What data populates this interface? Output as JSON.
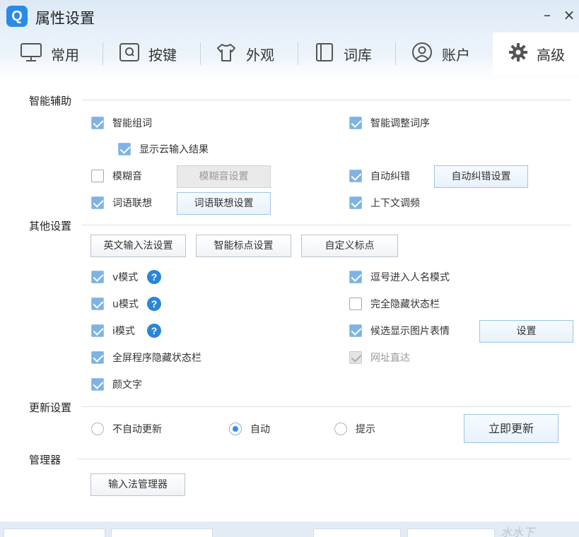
{
  "window": {
    "title": "属性设置",
    "logo_letter": "Q",
    "minimize": "–",
    "close": "×"
  },
  "tabs": [
    {
      "label": "常用",
      "icon": "monitor-icon"
    },
    {
      "label": "按键",
      "icon": "key-icon"
    },
    {
      "label": "外观",
      "icon": "tshirt-icon"
    },
    {
      "label": "词库",
      "icon": "book-icon"
    },
    {
      "label": "账户",
      "icon": "user-icon"
    },
    {
      "label": "高级",
      "icon": "gear-icon",
      "active": true
    }
  ],
  "smart_assist": {
    "label": "智能辅助",
    "smart_phrase": {
      "label": "智能组词",
      "checked": true
    },
    "smart_order": {
      "label": "智能调整词序",
      "checked": true
    },
    "cloud_result": {
      "label": "显示云输入结果",
      "checked": true
    },
    "fuzzy": {
      "label": "模糊音",
      "checked": false
    },
    "fuzzy_settings": "模糊音设置",
    "auto_correct": {
      "label": "自动纠错",
      "checked": true
    },
    "auto_correct_settings": "自动纠错设置",
    "association": {
      "label": "词语联想",
      "checked": true
    },
    "association_settings": "词语联想设置",
    "context_tuning": {
      "label": "上下文调频",
      "checked": true
    }
  },
  "other_settings": {
    "label": "其他设置",
    "english_settings": "英文输入法设置",
    "punct_settings": "智能标点设置",
    "custom_punct": "自定义标点",
    "v_mode": {
      "label": "v模式",
      "checked": true
    },
    "u_mode": {
      "label": "u模式",
      "checked": true
    },
    "i_mode": {
      "label": "i模式",
      "checked": true
    },
    "help_glyph": "?",
    "comma_name": {
      "label": "逗号进入人名模式",
      "checked": true
    },
    "hide_status": {
      "label": "完全隐藏状态栏",
      "checked": false
    },
    "show_emoji": {
      "label": "候选显示图片表情",
      "checked": true
    },
    "emoji_settings": "设置",
    "fullscreen_hide": {
      "label": "全屏程序隐藏状态栏",
      "checked": true
    },
    "url_direct": {
      "label": "网址直达",
      "checked": true,
      "disabled": true
    },
    "kaomoji": {
      "label": "颜文字",
      "checked": true
    }
  },
  "update": {
    "label": "更新设置",
    "options": [
      "不自动更新",
      "自动",
      "提示"
    ],
    "selected": "自动",
    "update_now": "立即更新"
  },
  "manager": {
    "label": "管理器",
    "button": "输入法管理器"
  },
  "watermark": "水水下"
}
